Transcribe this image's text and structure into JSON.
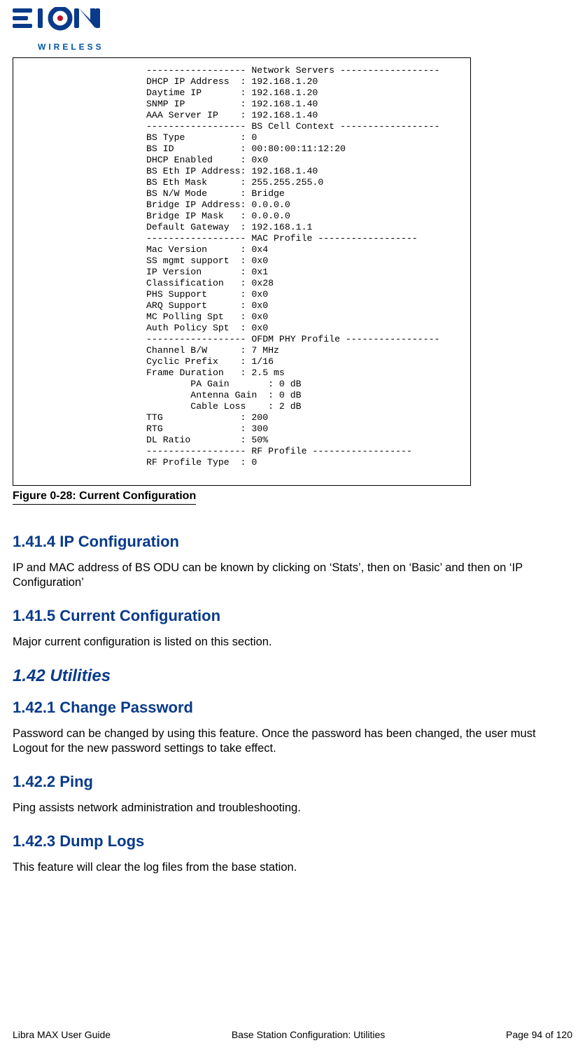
{
  "brand": {
    "wireless_label": "WIRELESS"
  },
  "terminal": {
    "text": "------------------ Network Servers ------------------\nDHCP IP Address  : 192.168.1.20\nDaytime IP       : 192.168.1.20\nSNMP IP          : 192.168.1.40\nAAA Server IP    : 192.168.1.40\n------------------ BS Cell Context ------------------\nBS Type          : 0\nBS ID            : 00:80:00:11:12:20\nDHCP Enabled     : 0x0\nBS Eth IP Address: 192.168.1.40\nBS Eth Mask      : 255.255.255.0\nBS N/W Mode      : Bridge\nBridge IP Address: 0.0.0.0\nBridge IP Mask   : 0.0.0.0\nDefault Gateway  : 192.168.1.1\n------------------ MAC Profile ------------------\nMac Version      : 0x4\nSS mgmt support  : 0x0\nIP Version       : 0x1\nClassification   : 0x28\nPHS Support      : 0x0\nARQ Support      : 0x0\nMC Polling Spt   : 0x0\nAuth Policy Spt  : 0x0\n------------------ OFDM PHY Profile -----------------\nChannel B/W      : 7 MHz\nCyclic Prefix    : 1/16\nFrame Duration   : 2.5 ms\n        PA Gain       : 0 dB\n        Antenna Gain  : 0 dB\n        Cable Loss    : 2 dB\nTTG              : 200\nRTG              : 300\nDL Ratio         : 50%\n------------------ RF Profile ------------------\nRF Profile Type  : 0"
  },
  "figure_caption": "Figure 0-28: Current Configuration",
  "sections": {
    "s1": {
      "title": "1.41.4 IP Configuration",
      "body": "IP and MAC address of BS ODU can be known by clicking on ‘Stats’, then on ‘Basic’ and then on ‘IP Configuration’"
    },
    "s2": {
      "title": "1.41.5 Current Configuration",
      "body": "Major current configuration is listed on this section."
    },
    "s_main": {
      "title": "1.42 Utilities"
    },
    "s3": {
      "title": "1.42.1 Change Password",
      "body": "Password can be changed by using this feature. Once the password has been changed, the user must Logout for the new password settings to take effect."
    },
    "s4": {
      "title": "1.42.2 Ping",
      "body": "Ping assists network administration and troubleshooting."
    },
    "s5": {
      "title": "1.42.3 Dump Logs",
      "body": "This feature will clear the log files from the base station."
    }
  },
  "footer": {
    "left": "Libra MAX User Guide",
    "center": "Base Station Configuration: Utilities",
    "right": "Page 94 of 120"
  }
}
